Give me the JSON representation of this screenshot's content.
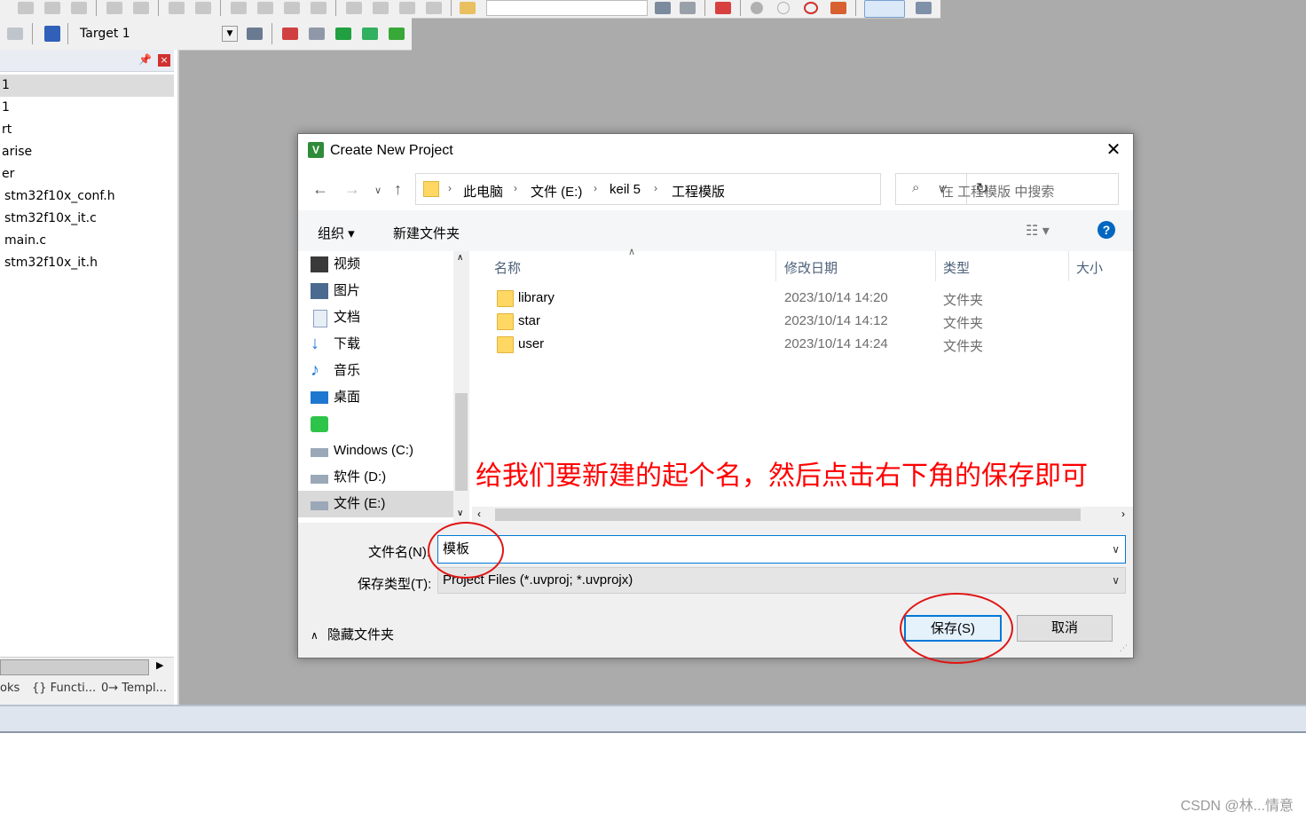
{
  "ide": {
    "target_name": "Target 1",
    "tree_items": [
      "1",
      "1",
      "rt",
      "arise",
      "er",
      "stm32f10x_conf.h",
      "stm32f10x_it.c",
      "main.c",
      "stm32f10x_it.h"
    ],
    "bottom_tabs": [
      "oks",
      "{} Functi...",
      "0→ Templ..."
    ]
  },
  "dialog": {
    "title": "Create New Project",
    "breadcrumb": [
      "此电脑",
      "文件 (E:)",
      "keil 5",
      "工程模版"
    ],
    "search_placeholder": "在 工程模版 中搜索",
    "organize_label": "组织 ▾",
    "new_folder_label": "新建文件夹",
    "nav_items": [
      {
        "label": "视频",
        "icon": "video-icon"
      },
      {
        "label": "图片",
        "icon": "pictures-icon"
      },
      {
        "label": "文档",
        "icon": "documents-icon"
      },
      {
        "label": "下载",
        "icon": "downloads-icon"
      },
      {
        "label": "音乐",
        "icon": "music-icon"
      },
      {
        "label": "桌面",
        "icon": "desktop-icon"
      },
      {
        "label": "",
        "icon": "iqiyi-icon"
      },
      {
        "label": "Windows (C:)",
        "icon": "drive-icon"
      },
      {
        "label": "软件 (D:)",
        "icon": "drive-icon"
      },
      {
        "label": "文件 (E:)",
        "icon": "drive-icon"
      }
    ],
    "columns": [
      "名称",
      "修改日期",
      "类型",
      "大小"
    ],
    "files": [
      {
        "name": "library",
        "modified": "2023/10/14 14:20",
        "type": "文件夹"
      },
      {
        "name": "star",
        "modified": "2023/10/14 14:12",
        "type": "文件夹"
      },
      {
        "name": "user",
        "modified": "2023/10/14 14:24",
        "type": "文件夹"
      }
    ],
    "filename_label": "文件名(N):",
    "filename_value": "模板",
    "filetype_label": "保存类型(T):",
    "filetype_value": "Project Files (*.uvproj; *.uvprojx)",
    "hide_folders_label": "隐藏文件夹",
    "save_label": "保存(S)",
    "cancel_label": "取消"
  },
  "annotation_text": "给我们要新建的起个名，然后点击右下角的保存即可",
  "watermark": "CSDN @林...情意",
  "colors": {
    "annotation": "#ff0000",
    "accent": "#0078d7"
  }
}
